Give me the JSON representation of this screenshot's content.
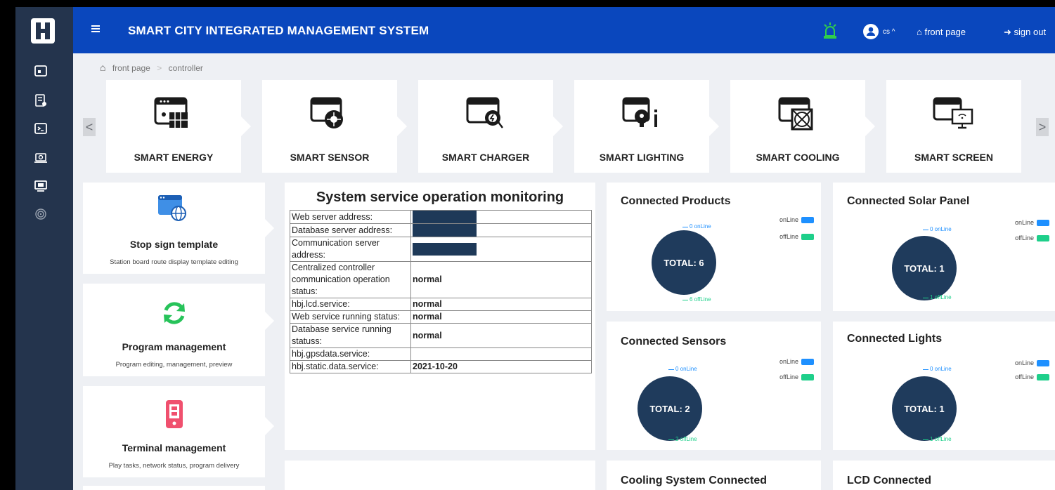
{
  "header": {
    "title": "SMART CITY INTEGRATED MANAGEMENT SYSTEM",
    "user": "cs ^",
    "front_page": "front page",
    "sign_out": "sign out"
  },
  "breadcrumb": {
    "home": "front page",
    "sep": ">",
    "current": "controller"
  },
  "nav": {
    "prev": "<",
    "next": ">"
  },
  "modules": [
    {
      "label": "SMART ENERGY",
      "icon": "smart-energy-icon"
    },
    {
      "label": "SMART SENSOR",
      "icon": "smart-sensor-icon"
    },
    {
      "label": "SMART CHARGER",
      "icon": "smart-charger-icon"
    },
    {
      "label": "SMART LIGHTING",
      "icon": "smart-lighting-icon"
    },
    {
      "label": "SMART COOLING",
      "icon": "smart-cooling-icon"
    },
    {
      "label": "SMART SCREEN",
      "icon": "smart-screen-icon"
    }
  ],
  "features": [
    {
      "title": "Stop sign template",
      "desc": "Station board route display template editing",
      "icon": "browser-globe-icon"
    },
    {
      "title": "Program management",
      "desc": "Program editing, management, preview",
      "icon": "refresh-icon"
    },
    {
      "title": "Terminal management",
      "desc": "Play tasks, network status, program delivery",
      "icon": "terminal-device-icon"
    }
  ],
  "monitor": {
    "title": "System service operation monitoring",
    "rows": [
      {
        "key": "Web server address:",
        "value": ""
      },
      {
        "key": "Database server address:",
        "value": ""
      },
      {
        "key": "Communication server address:",
        "value": ""
      },
      {
        "key": "Centralized controller communication operation status:",
        "value": "normal"
      },
      {
        "key": "hbj.lcd.service:",
        "value": "normal"
      },
      {
        "key": "Web service running status:",
        "value": "normal"
      },
      {
        "key": "Database service running statuss:",
        "value": "normal"
      },
      {
        "key": "hbj.gpsdata.service:",
        "value": ""
      },
      {
        "key": "hbj.static.data.service:",
        "value": "2021-10-20"
      }
    ]
  },
  "stats": [
    {
      "title": "Connected Products",
      "total": "TOTAL: 6",
      "online": "0 onLine",
      "offline": "6 offLine"
    },
    {
      "title": "Connected Solar Panel",
      "total": "TOTAL: 1",
      "online": "0 onLine",
      "offline": "1 offLine"
    },
    {
      "title": "Connected Sensors",
      "total": "TOTAL: 2",
      "online": "0 onLine",
      "offline": "2 offLine"
    },
    {
      "title": "Connected Lights",
      "total": "TOTAL: 1",
      "online": "0 onLine",
      "offline": "1 offLine"
    },
    {
      "title": "Cooling System Connected"
    },
    {
      "title": "LCD Connected"
    }
  ],
  "legend": {
    "online": "onLine",
    "offline": "offLine"
  },
  "colors": {
    "header": "#0a47bd",
    "sidebar": "#24344d",
    "donut": "#1f3b5c",
    "online": "#1e90ff",
    "offline": "#1ecf8a",
    "alarm": "#2fd04a"
  }
}
